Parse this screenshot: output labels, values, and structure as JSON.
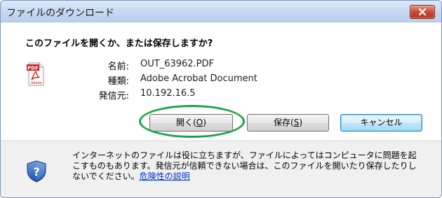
{
  "window": {
    "title": "ファイルのダウンロード"
  },
  "dialog": {
    "question": "このファイルを開くか、または保存しますか?",
    "fields": [
      {
        "label": "名前:",
        "value": "OUT_63962.PDF"
      },
      {
        "label": "種類:",
        "value": "Adobe Acrobat Document"
      },
      {
        "label": "発信元:",
        "value": "10.192.16.5"
      }
    ],
    "file_icon_badge": "PDF",
    "file_icon_caption": "Adobe"
  },
  "buttons": {
    "open_label": "開く(",
    "open_key": "O",
    "save_label": "保存(",
    "save_key": "S",
    "paren_close": ")",
    "cancel_label": "キャンセル"
  },
  "warning": {
    "text": "インターネットのファイルは役に立ちますが、ファイルによってはコンピュータに問題を起こすものもあります。発信元が信頼できない場合は、このファイルを開いたり保存したりしないでください。",
    "link_text": "危険性の説明"
  },
  "icons": {
    "close": "close-icon",
    "file": "pdf-file-icon",
    "warning": "security-shield-icon"
  },
  "colors": {
    "highlight": "#1ba34a",
    "close_button": "#c84b32",
    "link": "#0033cc"
  }
}
